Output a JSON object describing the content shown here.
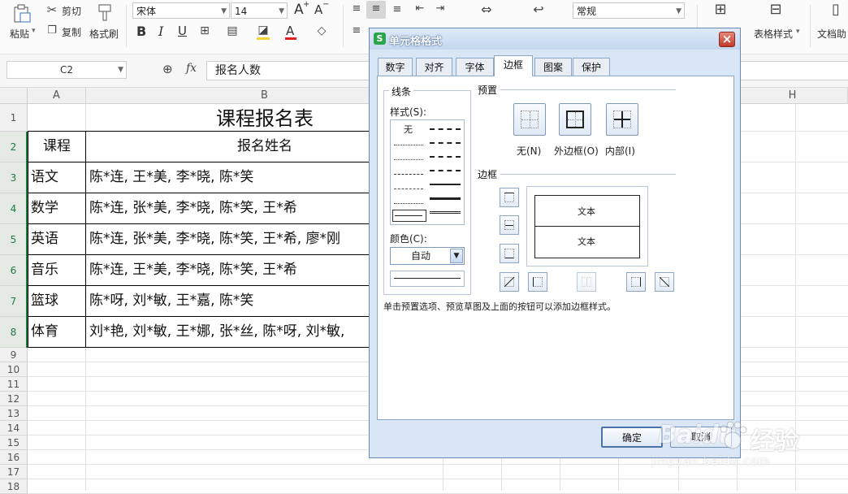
{
  "ribbon": {
    "paste": "粘贴",
    "cut": "剪切",
    "copy": "复制",
    "format_painter": "格式刷",
    "font_name": "宋体",
    "font_size": "14",
    "grow": "A",
    "shrink": "A",
    "bold": "B",
    "italic": "I",
    "underline": "U",
    "number_format": "常规",
    "table_style": "表格样式",
    "doc_assist": "文档助"
  },
  "formula_bar": {
    "name_box": "C2",
    "fx": "fx",
    "content": "报名人数"
  },
  "sheet": {
    "columns": [
      "A",
      "B",
      "H"
    ],
    "rows": [
      "1",
      "2",
      "3",
      "4",
      "5",
      "6",
      "7",
      "8",
      "9",
      "10",
      "11",
      "12",
      "13",
      "14",
      "15",
      "16",
      "17",
      "18"
    ],
    "title": "课程报名表",
    "header": {
      "course": "课程",
      "names": "报名姓名"
    },
    "data": [
      {
        "course": "语文",
        "names": "陈*连, 王*美, 李*晓, 陈*笑"
      },
      {
        "course": "数学",
        "names": "陈*连, 张*美, 李*晓, 陈*笑, 王*希"
      },
      {
        "course": "英语",
        "names": "陈*连, 张*美, 李*晓, 陈*笑, 王*希, 廖*刚"
      },
      {
        "course": "音乐",
        "names": "陈*连, 王*美, 李*晓, 陈*笑, 王*希"
      },
      {
        "course": "篮球",
        "names": "陈*呀, 刘*敏, 王*嘉, 陈*笑"
      },
      {
        "course": "体育",
        "names": "刘*艳, 刘*敏, 王*娜, 张*丝, 陈*呀, 刘*敏,"
      }
    ]
  },
  "dialog": {
    "icon_letter": "S",
    "title": "单元格格式",
    "close": "×",
    "tabs": [
      "数字",
      "对齐",
      "字体",
      "边框",
      "图案",
      "保护"
    ],
    "line_group": "线条",
    "style_label": "样式(S):",
    "style_none": "无",
    "color_label": "颜色(C):",
    "color_value": "自动",
    "preset_group": "预置",
    "presets": [
      "无(N)",
      "外边框(O)",
      "内部(I)"
    ],
    "border_group": "边框",
    "preview_text": [
      "文本",
      "文本"
    ],
    "hint": "单击预置选项、预览草图及上面的按钮可以添加边框样式。",
    "ok": "确定",
    "cancel": "取消"
  },
  "watermark": {
    "brand": "Baidu",
    "text": "经验",
    "url": "jingyan.baidu.com"
  }
}
